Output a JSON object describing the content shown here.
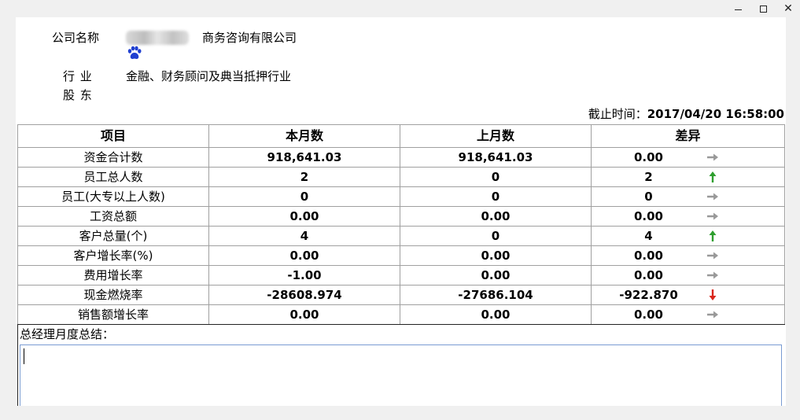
{
  "window": {
    "minimize_glyph": "—",
    "maximize_glyph": "☐",
    "close_glyph": "✕"
  },
  "info": {
    "company_label": "公司名称",
    "company_value": "商务咨询有限公司",
    "industry_label": "行 业",
    "industry_value": "金融、财务顾问及典当抵押行业",
    "shareholder_label": "股 东"
  },
  "cutoff": {
    "label": "截止时间：",
    "value": "2017/04/20 16:58:00"
  },
  "table": {
    "headers": [
      "项目",
      "本月数",
      "上月数",
      "差异"
    ],
    "rows": [
      {
        "item": "资金合计数",
        "current": "918,641.03",
        "previous": "918,641.03",
        "diff": "0.00",
        "trend": "flat"
      },
      {
        "item": "员工总人数",
        "current": "2",
        "previous": "0",
        "diff": "2",
        "trend": "up"
      },
      {
        "item": "员工(大专以上人数)",
        "current": "0",
        "previous": "0",
        "diff": "0",
        "trend": "flat"
      },
      {
        "item": "工资总额",
        "current": "0.00",
        "previous": "0.00",
        "diff": "0.00",
        "trend": "flat"
      },
      {
        "item": "客户总量(个)",
        "current": "4",
        "previous": "0",
        "diff": "4",
        "trend": "up"
      },
      {
        "item": "客户增长率(%)",
        "current": "0.00",
        "previous": "0.00",
        "diff": "0.00",
        "trend": "flat"
      },
      {
        "item": "费用增长率",
        "current": "-1.00",
        "previous": "0.00",
        "diff": "0.00",
        "trend": "flat"
      },
      {
        "item": "现金燃烧率",
        "current": "-28608.974",
        "previous": "-27686.104",
        "diff": "-922.870",
        "trend": "down"
      },
      {
        "item": "销售额增长率",
        "current": "0.00",
        "previous": "0.00",
        "diff": "0.00",
        "trend": "flat"
      }
    ]
  },
  "summary": {
    "label": "总经理月度总结：",
    "value": ""
  },
  "colors": {
    "up": "#2e9e2e",
    "down": "#d9261c",
    "flat": "#999999",
    "paw": "#1f3fd1"
  }
}
